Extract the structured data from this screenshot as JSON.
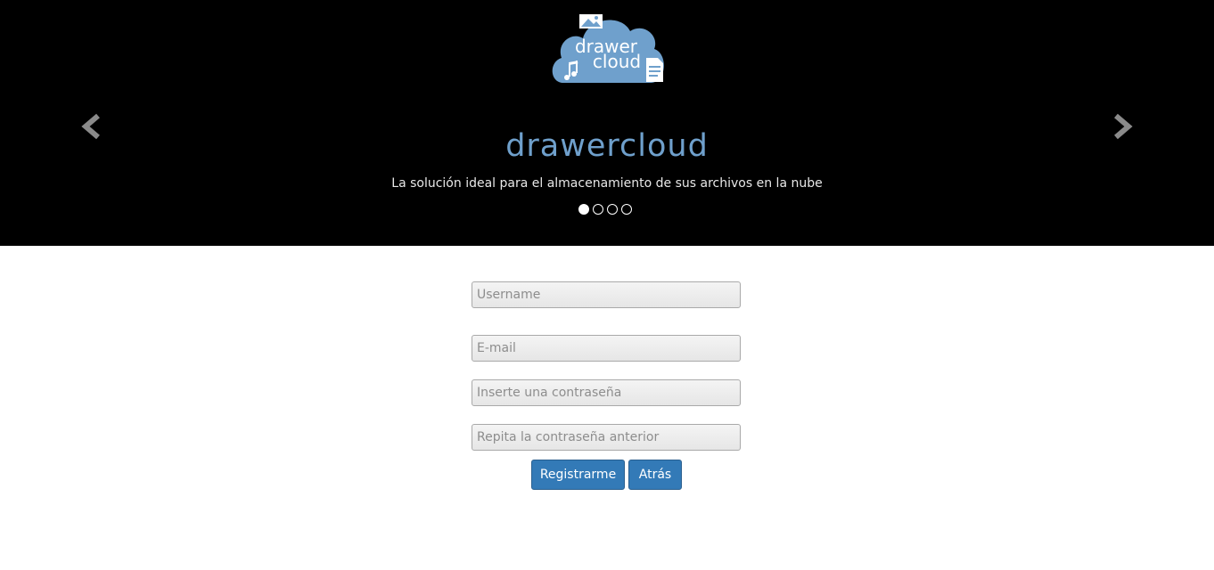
{
  "carousel": {
    "logo": {
      "line1": "drawer",
      "line2": "cloud",
      "cloud_color": "#6fa0cc"
    },
    "title": "drawercloud",
    "tagline": "La solución ideal para el almacenamiento de sus archivos en la nube",
    "indicators": [
      {
        "active": true
      },
      {
        "active": false
      },
      {
        "active": false
      },
      {
        "active": false
      }
    ],
    "prev_icon": "chevron-left-icon",
    "next_icon": "chevron-right-icon"
  },
  "form": {
    "username_placeholder": "Username",
    "email_placeholder": "E-mail",
    "password_placeholder": "Inserte una contraseña",
    "repeat_password_placeholder": "Repita la contraseña anterior",
    "register_label": "Registrarme",
    "back_label": "Atrás"
  },
  "colors": {
    "header_bg": "#000000",
    "brand": "#6fa0cc",
    "button": "#337ab7"
  }
}
